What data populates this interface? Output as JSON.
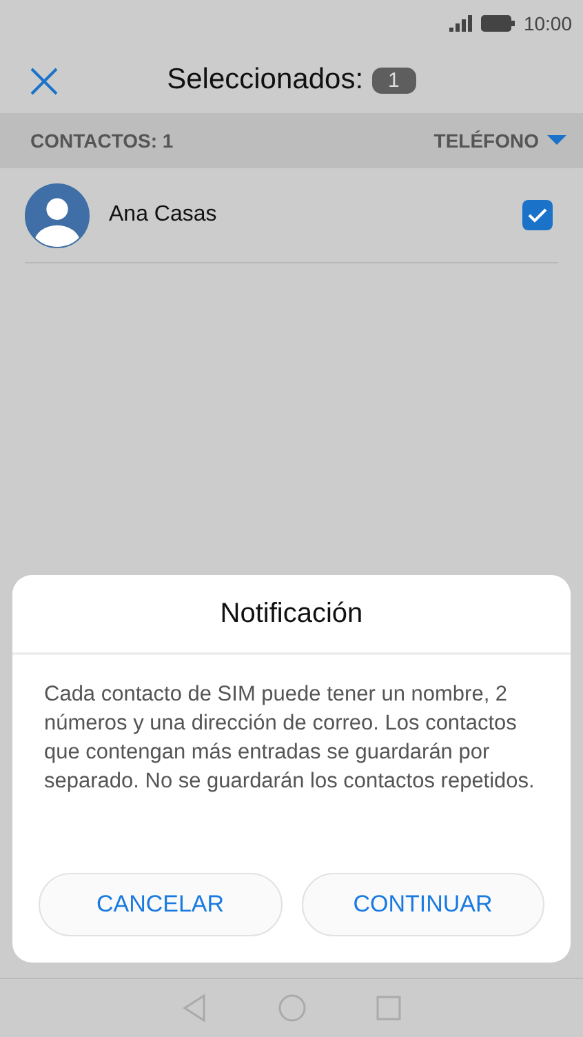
{
  "status_bar": {
    "time": "10:00"
  },
  "app_bar": {
    "title": "Seleccionados:",
    "count": "1"
  },
  "list_header": {
    "label": "CONTACTOS: 1",
    "sort": "TELÉFONO"
  },
  "contacts": [
    {
      "name": "Ana Casas",
      "checked": true
    }
  ],
  "dialog": {
    "title": "Notificación",
    "message": "Cada contacto de SIM puede tener un nombre, 2 números y una dirección de correo. Los contactos que contengan más entradas se guardarán por separado. No se guardarán los contactos repetidos.",
    "buttons": [
      "CANCELAR",
      "CONTINUAR"
    ]
  }
}
